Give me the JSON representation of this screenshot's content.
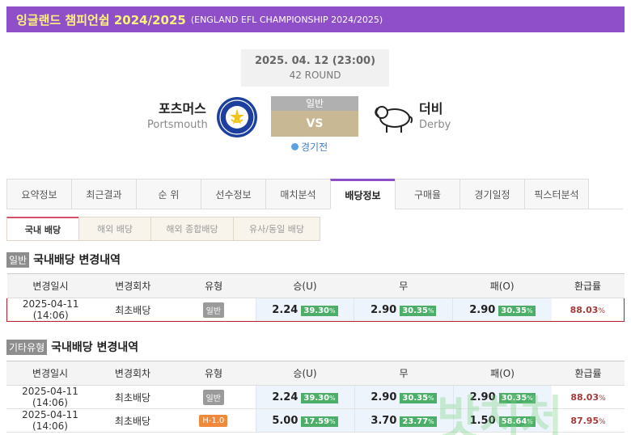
{
  "header": {
    "league_title": "잉글랜드 챔피언쉽 2024/2025",
    "league_sub": "(ENGLAND EFL CHAMPIONSHIP 2024/2025)"
  },
  "match": {
    "datetime": "2025. 04. 12 (23:00)",
    "round": "42 ROUND",
    "home_kr": "포츠머스",
    "home_en": "Portsmouth",
    "away_kr": "더비",
    "away_en": "Derby",
    "vs_type": "일반",
    "vs": "VS",
    "status": "경기전"
  },
  "tabs": [
    "요약정보",
    "최근결과",
    "순 위",
    "선수정보",
    "매치분석",
    "배당정보",
    "구매율",
    "경기일정",
    "픽스터분석"
  ],
  "active_tab": "배당정보",
  "subtabs": [
    "국내 배당",
    "해외 배당",
    "해외 종합배당",
    "유사/동일 배당"
  ],
  "section1": {
    "tag": "일반",
    "title": "국내배당 변경내역",
    "headers": [
      "변경일시",
      "변경회차",
      "유형",
      "승(U)",
      "무",
      "패(O)",
      "환급률"
    ],
    "rows": [
      {
        "date": "2025-04-11 (14:06)",
        "round": "최초배당",
        "type": "일반",
        "win": "2.24",
        "win_pct": "39.30",
        "draw": "2.90",
        "draw_pct": "30.35",
        "loss": "2.90",
        "loss_pct": "30.35",
        "refund": "88.03"
      }
    ]
  },
  "section2": {
    "tag": "기타유형",
    "title": "국내배당 변경내역",
    "headers": [
      "변경일시",
      "변경회차",
      "유형",
      "승(U)",
      "무",
      "패(O)",
      "환급률"
    ],
    "rows": [
      {
        "date": "2025-04-11 (14:06)",
        "round": "최초배당",
        "type": "일반",
        "win": "2.24",
        "win_pct": "39.30",
        "draw": "2.90",
        "draw_pct": "30.35",
        "loss": "2.90",
        "loss_pct": "30.35",
        "refund": "88.03"
      },
      {
        "date": "2025-04-11 (14:06)",
        "round": "최초배당",
        "type": "H-1.0",
        "win": "5.00",
        "win_pct": "17.59",
        "draw": "3.70",
        "draw_pct": "23.77",
        "loss": "1.50",
        "loss_pct": "58.64",
        "refund": "87.95"
      }
    ]
  },
  "pct_unit": "%",
  "watermark": "밧치처",
  "colors": {
    "accent": "#8e4fc8",
    "title_yellow": "#fff27a",
    "pct_green": "#4cae69",
    "refund_red": "#a23a3a",
    "handicap_orange": "#ef8a3c"
  }
}
